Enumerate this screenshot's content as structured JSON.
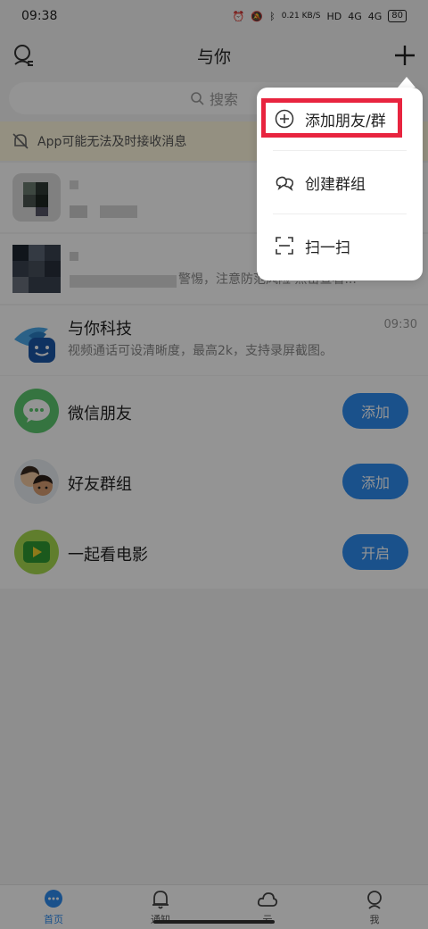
{
  "status_bar": {
    "time": "09:38",
    "net_speed": "0.21 KB/S",
    "net_label": "HD",
    "signal_1": "4G",
    "signal_2": "4G",
    "battery": "80"
  },
  "header": {
    "title": "与你"
  },
  "search": {
    "placeholder": "搜索"
  },
  "notice": {
    "text": "App可能无法及时接收消息"
  },
  "chats": [
    {
      "name": "",
      "preview": "",
      "time": ""
    },
    {
      "name": "",
      "preview": "警惕，注意防范风险 点击查看...",
      "time": ""
    },
    {
      "name": "与你科技",
      "preview": "视频通话可设清晰度，最高2k，支持录屏截图。",
      "time": "09:30"
    }
  ],
  "recommendations": [
    {
      "name": "微信朋友",
      "button": "添加"
    },
    {
      "name": "好友群组",
      "button": "添加"
    },
    {
      "name": "一起看电影",
      "button": "开启"
    }
  ],
  "popup_menu": {
    "items": [
      {
        "label": "添加朋友/群",
        "icon": "add-circle-icon"
      },
      {
        "label": "创建群组",
        "icon": "group-chat-icon"
      },
      {
        "label": "扫一扫",
        "icon": "scan-icon"
      }
    ]
  },
  "bottom_nav": [
    {
      "label": "首页",
      "active": true
    },
    {
      "label": "通知",
      "active": false
    },
    {
      "label": "云",
      "active": false
    },
    {
      "label": "我",
      "active": false
    }
  ],
  "colors": {
    "accent": "#2d8cf0",
    "highlight": "#e8243f",
    "notice_bg": "#fff8df"
  }
}
